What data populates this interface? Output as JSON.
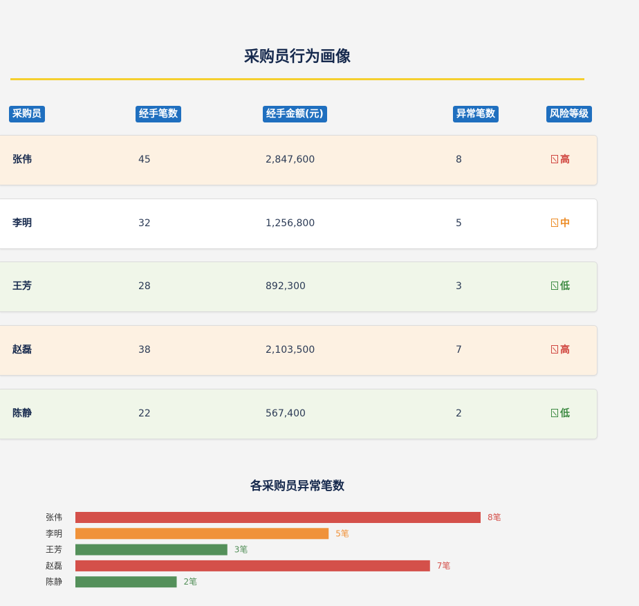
{
  "title": "采购员行为画像",
  "columns": [
    "采购员",
    "经手笔数",
    "经手金额(元)",
    "异常笔数",
    "风险等级"
  ],
  "rows": [
    {
      "name": "张伟",
      "count": "45",
      "amount": "2,847,600",
      "abnormal": "8",
      "risk": "高",
      "level": "high"
    },
    {
      "name": "李明",
      "count": "32",
      "amount": "1,256,800",
      "abnormal": "5",
      "risk": "中",
      "level": "mid"
    },
    {
      "name": "王芳",
      "count": "28",
      "amount": "892,300",
      "abnormal": "3",
      "risk": "低",
      "level": "low"
    },
    {
      "name": "赵磊",
      "count": "38",
      "amount": "2,103,500",
      "abnormal": "7",
      "risk": "高",
      "level": "high"
    },
    {
      "name": "陈静",
      "count": "22",
      "amount": "567,400",
      "abnormal": "2",
      "risk": "低",
      "level": "low"
    }
  ],
  "colors": {
    "high": "#d4504a",
    "mid": "#f0923a",
    "low": "#54905a",
    "accent": "#f5cf2e",
    "header": "#1f6fbf"
  },
  "chart_data": {
    "type": "bar",
    "orientation": "horizontal",
    "title": "各采购员异常笔数",
    "categories": [
      "张伟",
      "李明",
      "王芳",
      "赵磊",
      "陈静"
    ],
    "values": [
      8,
      5,
      3,
      7,
      2
    ],
    "labels": [
      "8笔",
      "5笔",
      "3笔",
      "7笔",
      "2笔"
    ],
    "levels": [
      "high",
      "mid",
      "low",
      "high",
      "low"
    ],
    "xlim": [
      0,
      8
    ]
  }
}
